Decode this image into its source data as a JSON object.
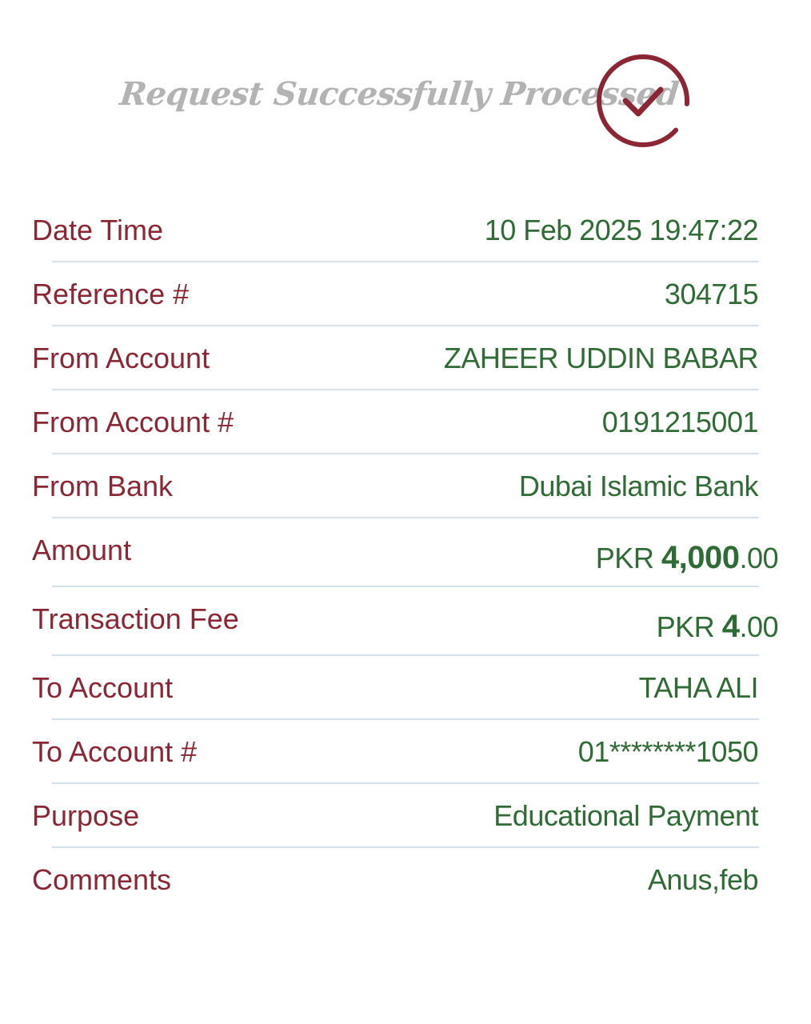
{
  "header": {
    "title": "Request Successfully Processed",
    "status_icon": "check-circle-icon",
    "accent_color": "#8b2635"
  },
  "colors": {
    "label": "#8b2635",
    "value": "#2f6b34",
    "divider": "#d6e0ea",
    "title": "#b3b3b3"
  },
  "details": {
    "date_time": {
      "label": "Date Time",
      "value": "10 Feb 2025 19:47:22"
    },
    "reference": {
      "label": "Reference #",
      "value": "304715"
    },
    "from_account": {
      "label": "From Account",
      "value": "ZAHEER UDDIN BABAR"
    },
    "from_account_number": {
      "label": "From Account #",
      "value": "0191215001"
    },
    "from_bank": {
      "label": "From Bank",
      "value": "Dubai Islamic Bank"
    },
    "amount": {
      "label": "Amount",
      "currency": "PKR",
      "major": "4,000",
      "minor": ".00"
    },
    "transaction_fee": {
      "label": "Transaction Fee",
      "currency": "PKR",
      "major": "4",
      "minor": ".00"
    },
    "to_account": {
      "label": "To Account",
      "value": "TAHA ALI"
    },
    "to_account_number": {
      "label": "To Account #",
      "value": "01********1050"
    },
    "purpose": {
      "label": "Purpose",
      "value": "Educational Payment"
    },
    "comments": {
      "label": "Comments",
      "value": "Anus,feb"
    }
  }
}
